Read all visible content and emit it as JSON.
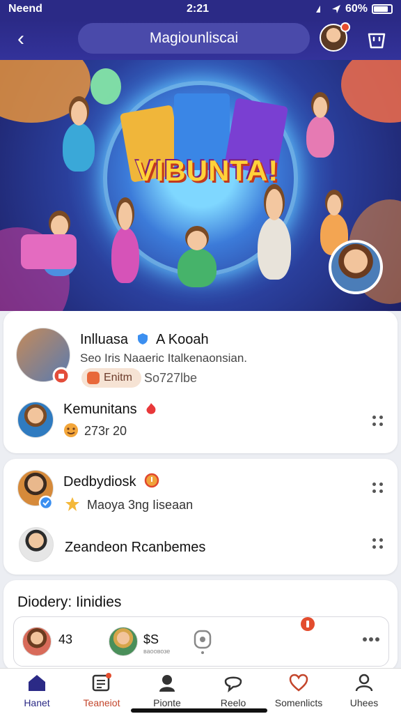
{
  "status": {
    "carrier": "Neend",
    "time": "2:21",
    "battery": "60%"
  },
  "header": {
    "title": "Magiounliscai",
    "back_label": "‹"
  },
  "hero": {
    "banner_text": "VIBUNTA!"
  },
  "feed": {
    "card1": {
      "row1": {
        "name": "Inlluasa",
        "name2": "A Kooah",
        "subtitle": "Seo Iris Naaeric Italkenaonsian.",
        "chip_label": "Enitm",
        "meta": "So727lbe"
      },
      "row2": {
        "name": "Kemunitans",
        "meta": "273r 20"
      }
    },
    "card2": {
      "row1": {
        "name": "Dedbydiosk",
        "meta": "Maoya 3ng Iiseaan"
      },
      "row2": {
        "name": "Zeandeon Rcanbemes"
      }
    },
    "card3": {
      "title": "Diodery: Iinidies",
      "items": [
        {
          "value": "43"
        },
        {
          "value": "$S"
        }
      ],
      "sub_label": "ваоовозе"
    }
  },
  "tabs": [
    {
      "label": "Hanet",
      "icon": "home-icon",
      "active": true
    },
    {
      "label": "Teaneiot",
      "icon": "news-icon",
      "active": false
    },
    {
      "label": "Pionte",
      "icon": "user-icon",
      "active": false
    },
    {
      "label": "Reelo",
      "icon": "chat-icon",
      "active": false
    },
    {
      "label": "Somenlicts",
      "icon": "heart-icon",
      "active": false
    },
    {
      "label": "Uhees",
      "icon": "profile-icon",
      "active": false
    }
  ],
  "colors": {
    "primary": "#2b2a86",
    "accent": "#e64d2e",
    "tab_active": "#c3452b"
  }
}
